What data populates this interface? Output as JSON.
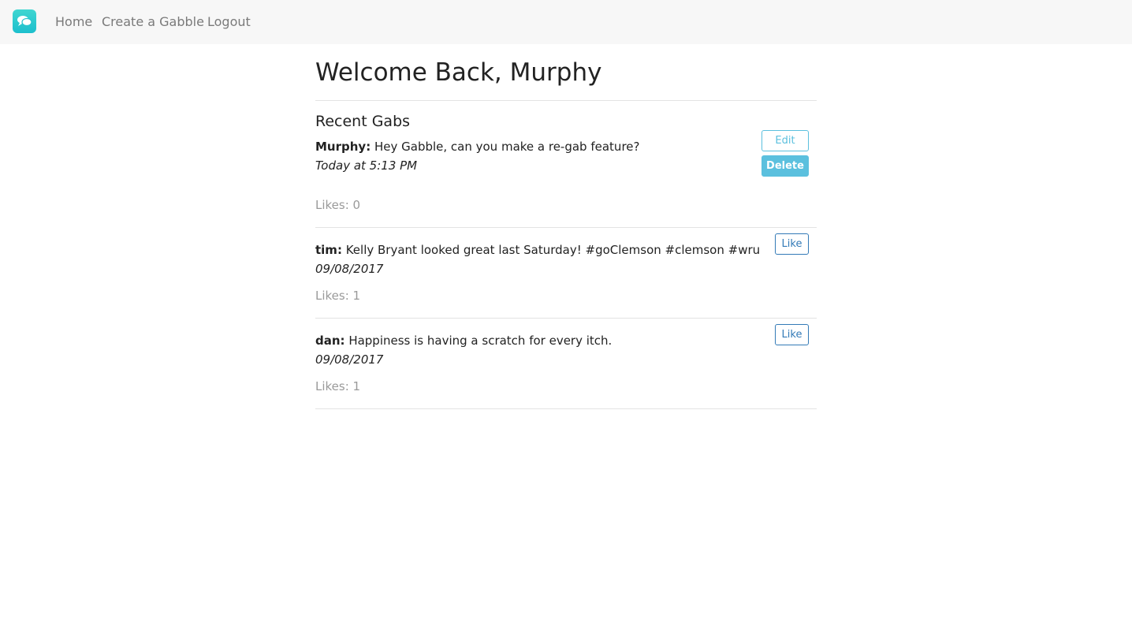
{
  "nav": {
    "logo_icon": "chat-bubbles-icon",
    "accent_color": "#1cbfcd",
    "links": [
      "Home",
      "Create a Gabble",
      "Logout"
    ]
  },
  "page": {
    "title": "Welcome Back, Murphy",
    "section_title": "Recent Gabs"
  },
  "gabs": [
    {
      "author": "Murphy:",
      "text": " Hey Gabble, can you make a re-gab feature?",
      "date": "Today at 5:13 PM",
      "likes": "Likes: 0",
      "edit_label": "Edit",
      "delete_label": "Delete"
    },
    {
      "author": "tim:",
      "text": " Kelly Bryant looked great last Saturday! #goClemson #clemson #wru",
      "date": "09/08/2017",
      "likes": "Likes: 1",
      "like_label": "Like"
    },
    {
      "author": "dan:",
      "text": " Happiness is having a scratch for every itch.",
      "date": "09/08/2017",
      "likes": "Likes: 1",
      "like_label": "Like"
    }
  ]
}
